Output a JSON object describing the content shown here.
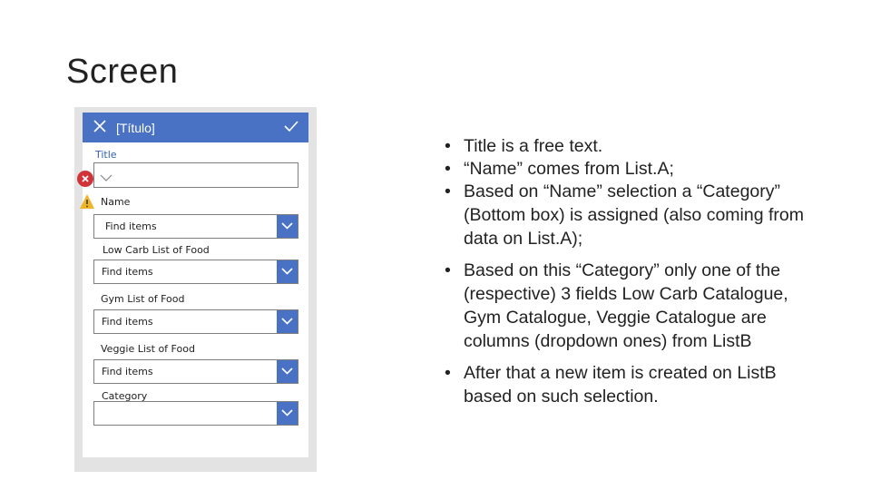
{
  "slide": {
    "title": "Screen"
  },
  "form": {
    "header_title": "[Título]",
    "title_label": "Title",
    "fields": [
      {
        "label": "Name",
        "placeholder": "Find items"
      },
      {
        "label": "Low Carb List of Food",
        "placeholder": "Find items"
      },
      {
        "label": "Gym List of Food",
        "placeholder": "Find items"
      },
      {
        "label": "Veggie List of Food",
        "placeholder": "Find items"
      },
      {
        "label": "Category",
        "placeholder": ""
      }
    ]
  },
  "notes": {
    "bullet_char": "•",
    "bullets": [
      "Title is a free text.",
      "“Name” comes from List.A;",
      "Based on “Name” selection a “Category” (Bottom box) is assigned (also coming from data on List.A);",
      "Based on this “Category” only one of the (respective) 3 fields Low Carb Catalogue, Gym Catalogue, Veggie Catalogue are columns (dropdown ones) from ListB",
      "After that a new item is created on ListB based on such selection."
    ]
  },
  "colors": {
    "header": "#4a72c4",
    "error": "#d13438",
    "warning": "#f0b429"
  }
}
